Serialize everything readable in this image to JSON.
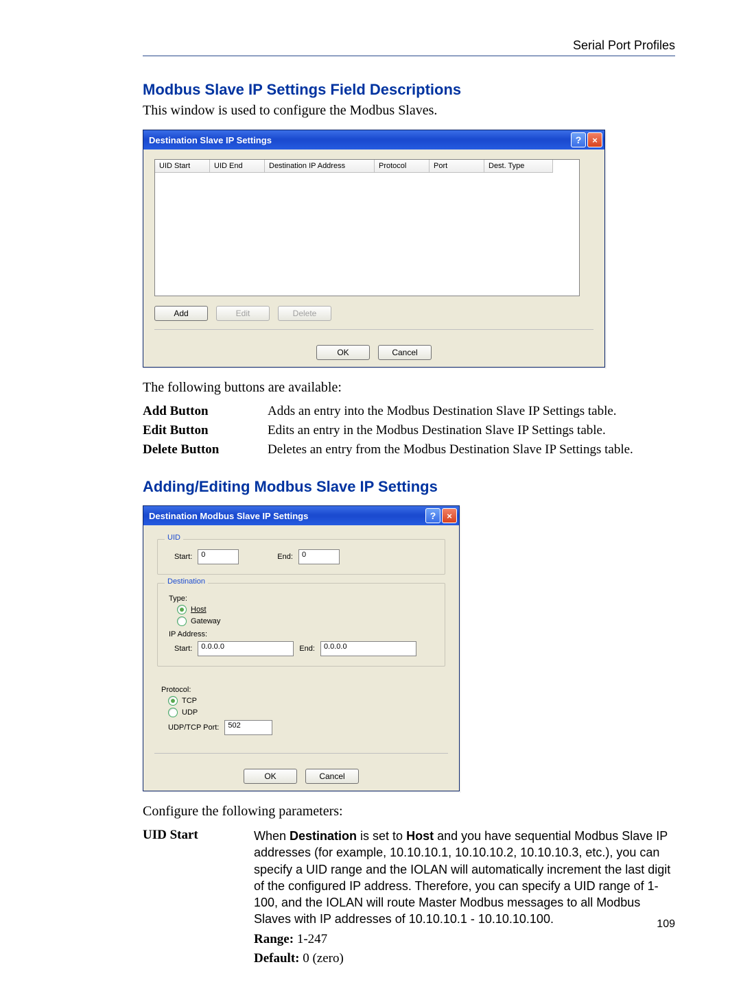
{
  "header": {
    "running": "Serial Port Profiles"
  },
  "sec1": {
    "title": "Modbus Slave IP Settings Field Descriptions",
    "intro": "This window is used to configure the Modbus Slaves.",
    "tail": "The following buttons are available:"
  },
  "dlg1": {
    "title": "Destination Slave IP Settings",
    "cols": [
      "UID Start",
      "UID End",
      "Destination IP Address",
      "Protocol",
      "Port",
      "Dest. Type"
    ],
    "buttons": {
      "add": "Add",
      "edit": "Edit",
      "del": "Delete",
      "ok": "OK",
      "cancel": "Cancel"
    }
  },
  "buttons_table": [
    {
      "name": "Add Button",
      "desc": "Adds an entry into the Modbus Destination Slave IP Settings table."
    },
    {
      "name": "Edit Button",
      "desc": "Edits an entry in the Modbus Destination Slave IP Settings table."
    },
    {
      "name": "Delete Button",
      "desc": "Deletes an entry from the Modbus Destination Slave IP Settings table."
    }
  ],
  "sec2": {
    "title": "Adding/Editing Modbus Slave IP Settings",
    "tail": "Configure the following parameters:"
  },
  "dlg2": {
    "title": "Destination Modbus Slave IP Settings",
    "uid": {
      "legend": "UID",
      "start_lbl": "Start:",
      "start_val": "0",
      "end_lbl": "End:",
      "end_val": "0"
    },
    "dest": {
      "legend": "Destination",
      "type_lbl": "Type:",
      "host_lbl": "Host",
      "gateway_lbl": "Gateway",
      "ip_lbl": "IP Address:",
      "ip_start_lbl": "Start:",
      "ip_start_val": "0.0.0.0",
      "ip_end_lbl": "End:",
      "ip_end_val": "0.0.0.0"
    },
    "proto": {
      "legend": "Protocol:",
      "tcp_lbl": "TCP",
      "udp_lbl": "UDP",
      "port_lbl": "UDP/TCP Port:",
      "port_val": "502"
    },
    "ok": "OK",
    "cancel": "Cancel"
  },
  "params": {
    "uid_start": {
      "label": "UID Start",
      "desc_pre": "When ",
      "desc_b1": "Destination",
      "desc_mid1": " is set to ",
      "desc_b2": "Host",
      "desc_post": " and you have sequential Modbus Slave IP addresses (for example, 10.10.10.1, 10.10.10.2, 10.10.10.3, etc.), you can specify a UID range and the IOLAN will automatically increment the last digit of the configured IP address. Therefore, you can specify a UID range of 1-100, and the IOLAN will route Master Modbus messages to all Modbus Slaves with IP addresses of 10.10.10.1 - 10.10.10.100.",
      "range_lbl": "Range:",
      "range_val": " 1-247",
      "default_lbl": "Default:",
      "default_val": " 0 (zero)"
    }
  },
  "page_number": "109"
}
